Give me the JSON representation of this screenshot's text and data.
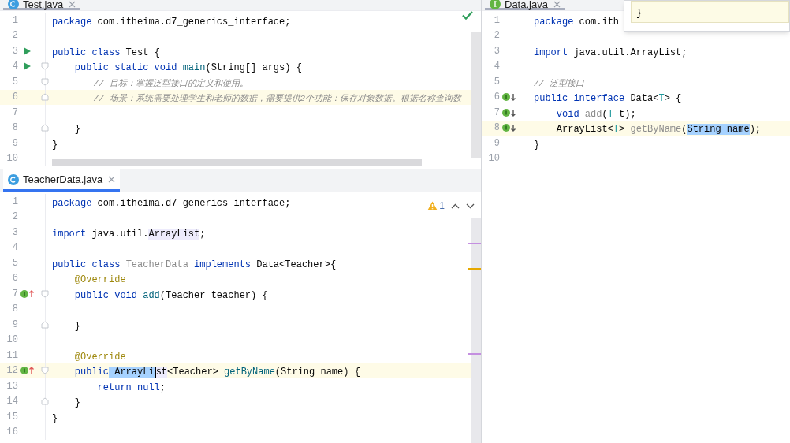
{
  "panes": [
    {
      "tab": {
        "label": "Test.java",
        "kind": "class",
        "selected": false
      },
      "inspection": {
        "kind": "ok"
      },
      "lines": [
        {
          "n": "1",
          "current": false,
          "tokens": [
            {
              "kind": "kw",
              "text": "package"
            },
            {
              "kind": "plain",
              "text": " com.itheima.d7_generics_interface;"
            }
          ]
        },
        {
          "n": "2",
          "current": false
        },
        {
          "n": "3",
          "current": false,
          "gutter": {
            "kind": "run"
          },
          "tokens": [
            {
              "kind": "kw",
              "text": "public class"
            },
            {
              "kind": "plain",
              "text": " Test {"
            }
          ]
        },
        {
          "n": "4",
          "current": false,
          "gutter": {
            "kind": "run"
          },
          "fold": {
            "kind": "open"
          },
          "tokens": [
            {
              "kind": "kw",
              "text": "    public static void "
            },
            {
              "kind": "method",
              "text": "main"
            },
            {
              "kind": "plain",
              "text": "(String[] args) {"
            }
          ]
        },
        {
          "n": "5",
          "current": false,
          "fold": {
            "kind": "open"
          },
          "tokens": [
            {
              "kind": "comment",
              "text": "        // 目标：掌握泛型接口的定义和使用。"
            }
          ]
        },
        {
          "n": "6",
          "current": true,
          "fold": {
            "kind": "close"
          },
          "tokens": [
            {
              "kind": "comment",
              "text": "        // 场景：系统需要处理学生和老师的数据，需要提供2个功能：保存对象数据。根据名称查询数"
            }
          ]
        },
        {
          "n": "7",
          "current": false
        },
        {
          "n": "8",
          "current": false,
          "fold": {
            "kind": "close"
          },
          "tokens": [
            {
              "kind": "plain",
              "text": "    }"
            }
          ]
        },
        {
          "n": "9",
          "current": false,
          "tokens": [
            {
              "kind": "plain",
              "text": "}"
            }
          ]
        },
        {
          "n": "10",
          "current": false
        }
      ]
    },
    {
      "tab": {
        "label": "TeacherData.java",
        "kind": "class",
        "selected": true
      },
      "inspection": {
        "kind": "warning",
        "count": "1"
      },
      "lines": [
        {
          "n": "1",
          "current": false,
          "tokens": [
            {
              "kind": "kw",
              "text": "package"
            },
            {
              "kind": "plain",
              "text": " com.itheima.d7_generics_interface;"
            }
          ]
        },
        {
          "n": "2",
          "current": false
        },
        {
          "n": "3",
          "current": false,
          "tokens": [
            {
              "kind": "kw",
              "text": "import"
            },
            {
              "kind": "plain",
              "text": " java.util."
            },
            {
              "kind": "plain",
              "text": "ArrayList",
              "usage": true
            },
            {
              "kind": "plain",
              "text": ";"
            }
          ]
        },
        {
          "n": "4",
          "current": false
        },
        {
          "n": "5",
          "current": false,
          "tokens": [
            {
              "kind": "kw",
              "text": "public class "
            },
            {
              "kind": "unused",
              "text": "TeacherData "
            },
            {
              "kind": "kw",
              "text": "implements "
            },
            {
              "kind": "plain",
              "text": "Data<Teacher>{"
            }
          ]
        },
        {
          "n": "6",
          "current": false,
          "tokens": [
            {
              "kind": "annotation",
              "text": "    @Override"
            }
          ]
        },
        {
          "n": "7",
          "current": false,
          "gutter": {
            "kind": "override"
          },
          "fold": {
            "kind": "open"
          },
          "tokens": [
            {
              "kind": "kw",
              "text": "    public void "
            },
            {
              "kind": "method",
              "text": "add"
            },
            {
              "kind": "plain",
              "text": "(Teacher teacher) {"
            }
          ]
        },
        {
          "n": "8",
          "current": false
        },
        {
          "n": "9",
          "current": false,
          "fold": {
            "kind": "close"
          },
          "tokens": [
            {
              "kind": "plain",
              "text": "    }"
            }
          ]
        },
        {
          "n": "10",
          "current": false
        },
        {
          "n": "11",
          "current": false,
          "tokens": [
            {
              "kind": "annotation",
              "text": "    @Override"
            }
          ]
        },
        {
          "n": "12",
          "current": true,
          "gutter": {
            "kind": "override"
          },
          "fold": {
            "kind": "open"
          },
          "tokens": [
            {
              "kind": "kw",
              "text": "    public"
            },
            {
              "kind": "plain",
              "text": " ArrayLi",
              "selected": true
            },
            {
              "kind": "plain",
              "text": "st",
              "usage": true,
              "caret": true
            },
            {
              "kind": "plain",
              "text": "<Teacher> "
            },
            {
              "kind": "method",
              "text": "getByName"
            },
            {
              "kind": "plain",
              "text": "(String name) {"
            }
          ]
        },
        {
          "n": "13",
          "current": false,
          "tokens": [
            {
              "kind": "kw",
              "text": "        return null"
            },
            {
              "kind": "plain",
              "text": ";"
            }
          ]
        },
        {
          "n": "14",
          "current": false,
          "fold": {
            "kind": "close"
          },
          "tokens": [
            {
              "kind": "plain",
              "text": "    }"
            }
          ]
        },
        {
          "n": "15",
          "current": false,
          "tokens": [
            {
              "kind": "plain",
              "text": "}"
            }
          ]
        },
        {
          "n": "16",
          "current": false
        }
      ]
    },
    {
      "tab": {
        "label": "Data.java",
        "kind": "interface",
        "selected": false
      },
      "lines": [
        {
          "n": "1",
          "current": false,
          "tokens": [
            {
              "kind": "kw",
              "text": "package"
            },
            {
              "kind": "plain",
              "text": " com.ith"
            }
          ]
        },
        {
          "n": "2",
          "current": false
        },
        {
          "n": "3",
          "current": false,
          "tokens": [
            {
              "kind": "kw",
              "text": "import"
            },
            {
              "kind": "plain",
              "text": " java.util.ArrayList;"
            }
          ]
        },
        {
          "n": "4",
          "current": false
        },
        {
          "n": "5",
          "current": false,
          "tokens": [
            {
              "kind": "comment",
              "text": "// 泛型接口"
            }
          ]
        },
        {
          "n": "6",
          "current": false,
          "gutter": {
            "kind": "implemented"
          },
          "tokens": [
            {
              "kind": "kw",
              "text": "public interface"
            },
            {
              "kind": "plain",
              "text": " Data<"
            },
            {
              "kind": "tparam",
              "text": "T"
            },
            {
              "kind": "plain",
              "text": "> {"
            }
          ]
        },
        {
          "n": "7",
          "current": false,
          "gutter": {
            "kind": "implemented"
          },
          "tokens": [
            {
              "kind": "kw",
              "text": "    void "
            },
            {
              "kind": "unused",
              "text": "add"
            },
            {
              "kind": "plain",
              "text": "("
            },
            {
              "kind": "tparam",
              "text": "T"
            },
            {
              "kind": "plain",
              "text": " t);"
            }
          ]
        },
        {
          "n": "8",
          "current": true,
          "gutter": {
            "kind": "implemented"
          },
          "tokens": [
            {
              "kind": "plain",
              "text": "    ArrayList<"
            },
            {
              "kind": "tparam",
              "text": "T"
            },
            {
              "kind": "plain",
              "text": "> "
            },
            {
              "kind": "unused",
              "text": "getByName"
            },
            {
              "kind": "plain",
              "text": "("
            },
            {
              "kind": "plain",
              "text": "String name",
              "selected": true
            },
            {
              "kind": "plain",
              "text": ");"
            }
          ]
        },
        {
          "n": "9",
          "current": false,
          "tokens": [
            {
              "kind": "plain",
              "text": "}"
            }
          ]
        },
        {
          "n": "10",
          "current": false
        }
      ]
    }
  ],
  "popup": {
    "text": "}"
  }
}
